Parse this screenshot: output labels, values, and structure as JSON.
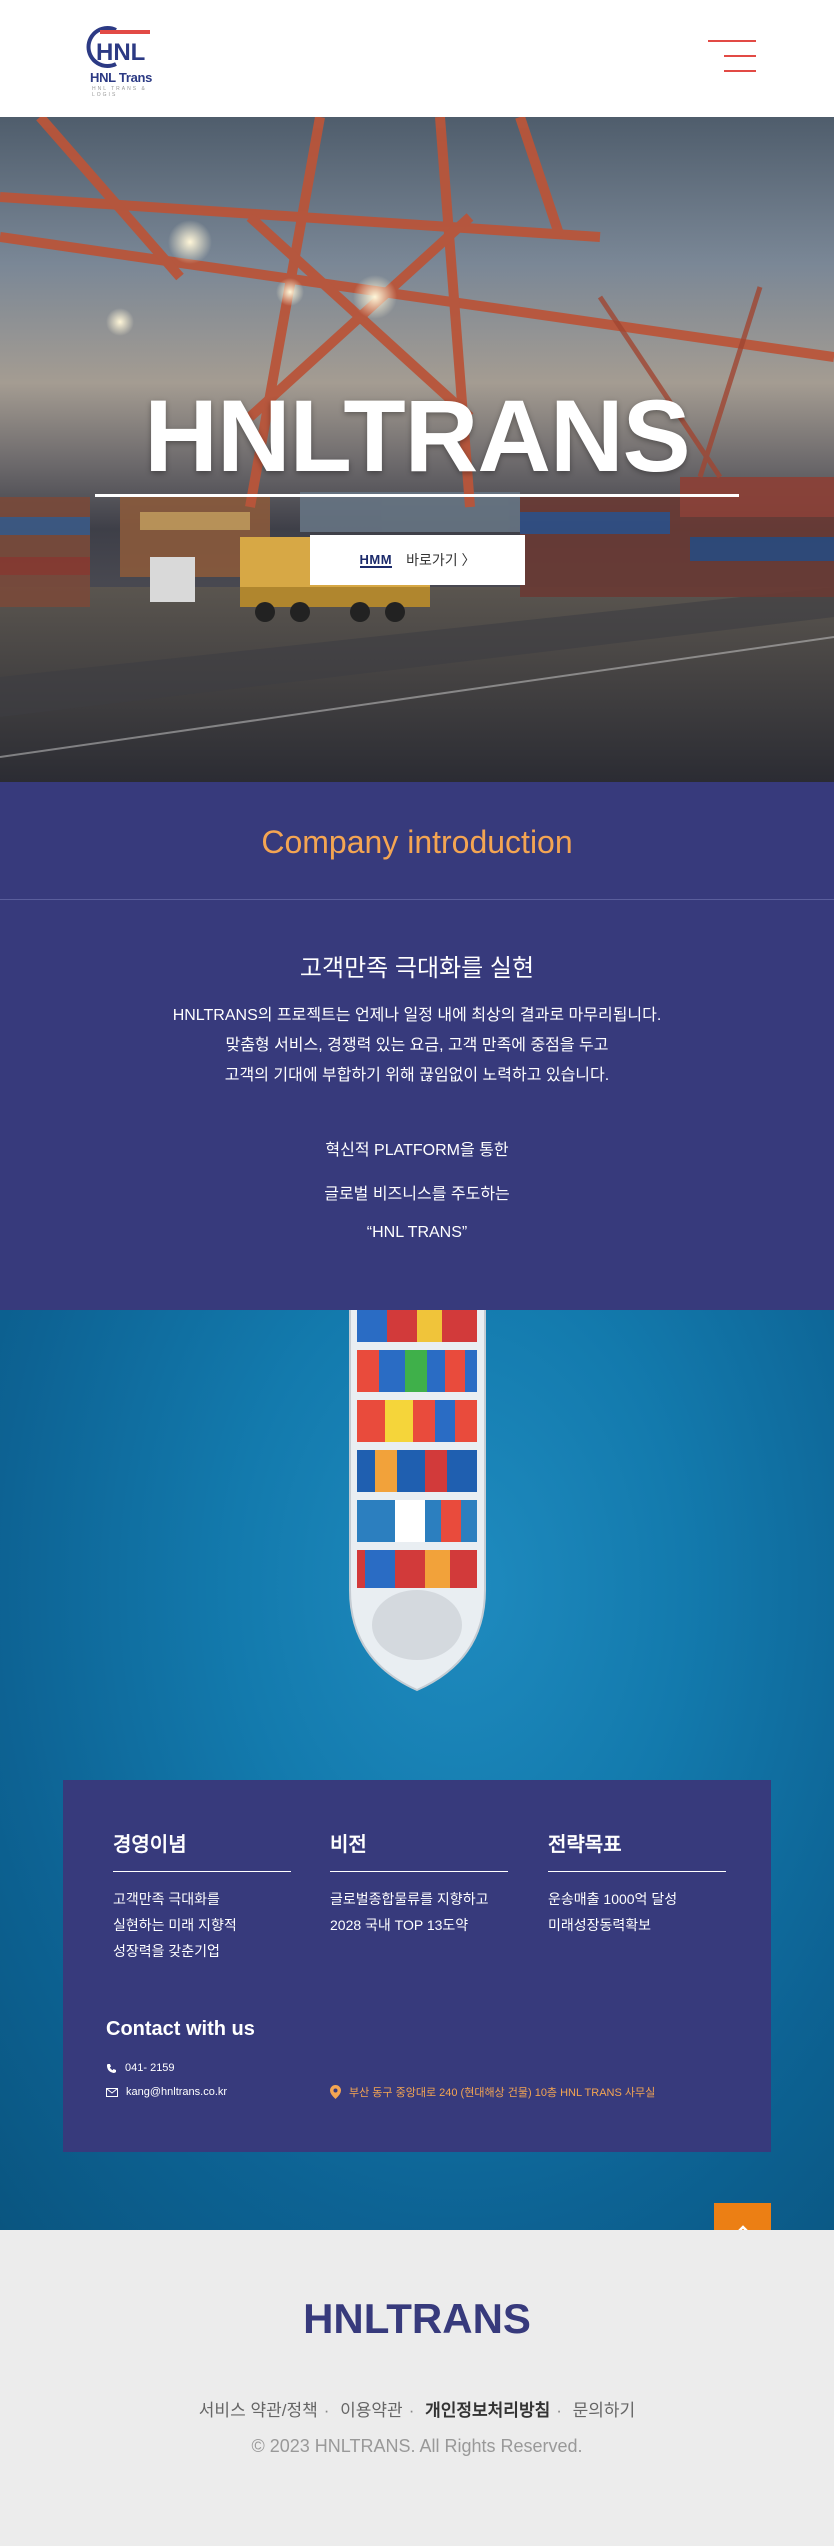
{
  "header": {
    "logo_text": "HNL Trans",
    "logo_mark": "HNL",
    "logo_sub": "HNL TRANS & LOGIS",
    "menu_icon": "hamburger-menu-icon"
  },
  "hero": {
    "title": "HNLTRANS",
    "button_brand": "HMM",
    "button_label": "바로가기 〉"
  },
  "intro": {
    "section_title": "Company introduction",
    "heading": "고객만족 극대화를 실현",
    "paragraph": [
      "HNLTRANS의 프로젝트는 언제나 일정 내에 최상의 결과로 마무리됩니다.",
      "맞춤형 서비스, 경쟁력 있는 요금, 고객 만족에 중점을 두고",
      "고객의 기대에 부합하기 위해 끊임없이 노력하고 있습니다."
    ],
    "slogan": [
      "혁신적 PLATFORM을 통한",
      "글로벌 비즈니스를 주도하는",
      "“HNL TRANS”"
    ]
  },
  "info": {
    "columns": [
      {
        "title": "경영이념",
        "items": [
          "고객만족 극대화를",
          "실현하는 미래 지향적",
          "성장력을 갖춘기업"
        ]
      },
      {
        "title": "비전",
        "items": [
          "글로벌종합물류를 지향하고",
          "2028 국내 TOP 13도약"
        ]
      },
      {
        "title": "전략목표",
        "items": [
          "운송매출 1000억 달성",
          "미래성장동력확보"
        ]
      }
    ],
    "contact_title": "Contact with us",
    "phone": "041- 2159",
    "email": "kang@hnltrans.co.kr",
    "address": "부산 동구 중앙대로 240 (현대해상 건물) 10층 HNL TRANS 사무실"
  },
  "footer": {
    "logo": "HNLTRANS",
    "links": [
      "서비스 약관/정책",
      "이용약관",
      "개인정보처리방침",
      "문의하기"
    ],
    "copyright": "© 2023 HNLTRANS. All Rights Reserved."
  },
  "colors": {
    "navy": "#373a7c",
    "orange": "#f4a552",
    "accent_red": "#e24a45",
    "top_button": "#ec7f14"
  }
}
